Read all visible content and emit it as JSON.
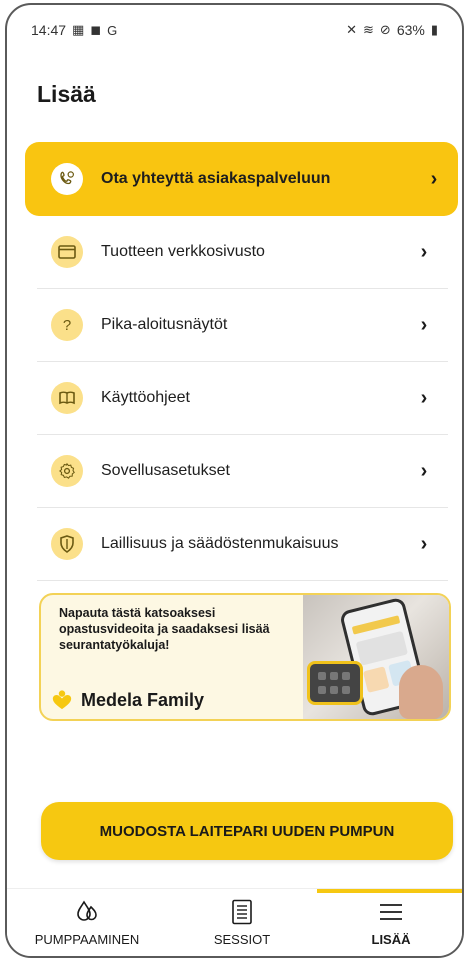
{
  "status_bar": {
    "time": "14:47",
    "left_icons": [
      "notification-icon",
      "message-icon",
      "G"
    ],
    "battery": "63%"
  },
  "page": {
    "title": "Lisää"
  },
  "menu": {
    "items": [
      {
        "label": "Ota yhteyttä asiakaspalveluun",
        "icon": "phone-support-icon",
        "highlight": true
      },
      {
        "label": "Tuotteen verkkosivusto",
        "icon": "browser-window-icon"
      },
      {
        "label": "Pika-aloitusnäytöt",
        "icon": "question-icon"
      },
      {
        "label": "Käyttöohjeet",
        "icon": "book-icon"
      },
      {
        "label": "Sovellusasetukset",
        "icon": "settings-gear-icon"
      },
      {
        "label": "Laillisuus ja säädöstenmukaisuus",
        "icon": "shield-icon"
      }
    ]
  },
  "banner": {
    "text": "Napauta tästä katsoaksesi opastusvideoita ja saadaksesi lisää seurantatyökaluja!",
    "brand": "Medela Family"
  },
  "cta": {
    "label": "MUODOSTA LAITEPARI UUDEN PUMPUN"
  },
  "tabs": [
    {
      "label": "PUMPPAAMINEN",
      "icon": "drops-icon"
    },
    {
      "label": "SESSIOT",
      "icon": "document-list-icon"
    },
    {
      "label": "LISÄÄ",
      "icon": "hamburger-menu-icon",
      "active": true
    }
  ],
  "colors": {
    "accent": "#f6c811",
    "icon_bg": "#fbe08a",
    "banner_bg": "#fdf8e3"
  }
}
